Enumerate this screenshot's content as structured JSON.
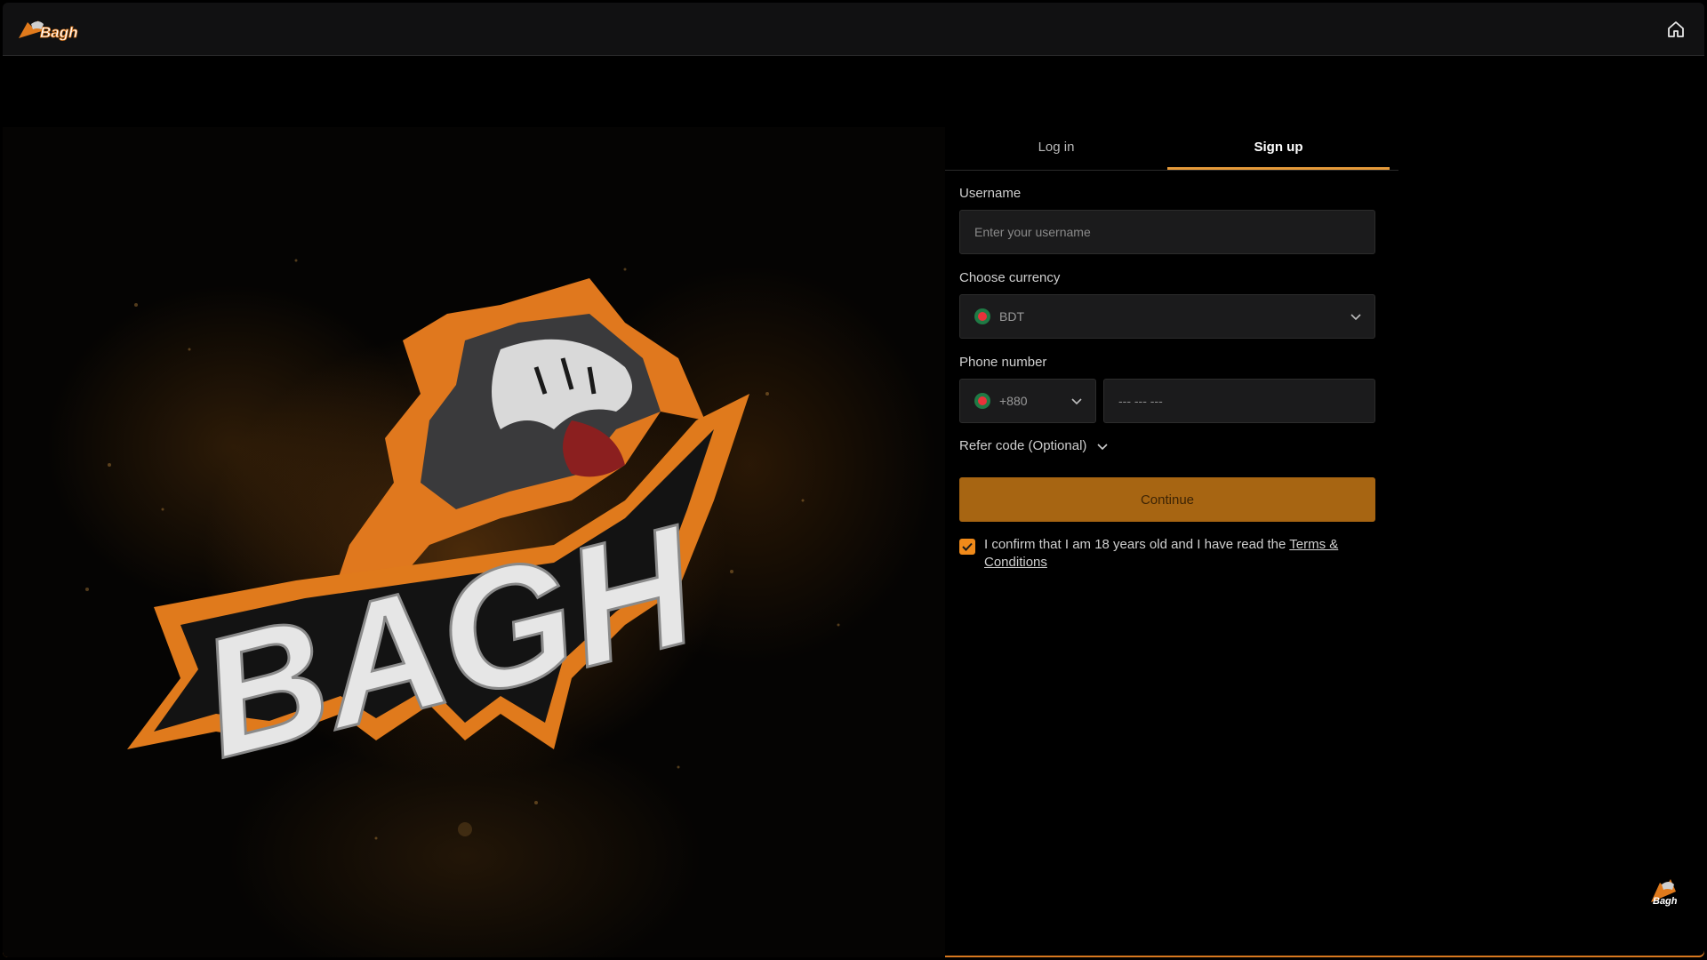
{
  "brand": {
    "name": "BAGH",
    "logo_text": "Bagh"
  },
  "header": {
    "home_icon": "home-icon"
  },
  "tabs": [
    {
      "label": "Log in",
      "active": false
    },
    {
      "label": "Sign up",
      "active": true
    }
  ],
  "form": {
    "username": {
      "label": "Username",
      "placeholder": "Enter your username",
      "value": ""
    },
    "currency": {
      "label": "Choose currency",
      "value": "BDT"
    },
    "phone": {
      "label": "Phone number",
      "code": "+880",
      "placeholder": "--- --- ---",
      "value": ""
    },
    "refer": {
      "label": "Refer code (Optional)"
    },
    "continue_label": "Continue",
    "confirm": {
      "checked": true,
      "text": "I confirm that I am 18 years old and I have read the ",
      "link": "Terms & Conditions"
    }
  },
  "colors": {
    "accent": "#e59a3a",
    "button": "#a76512",
    "checkbox": "#f08a1a",
    "panel": "#111112",
    "input_bg": "#1b1b1c"
  }
}
